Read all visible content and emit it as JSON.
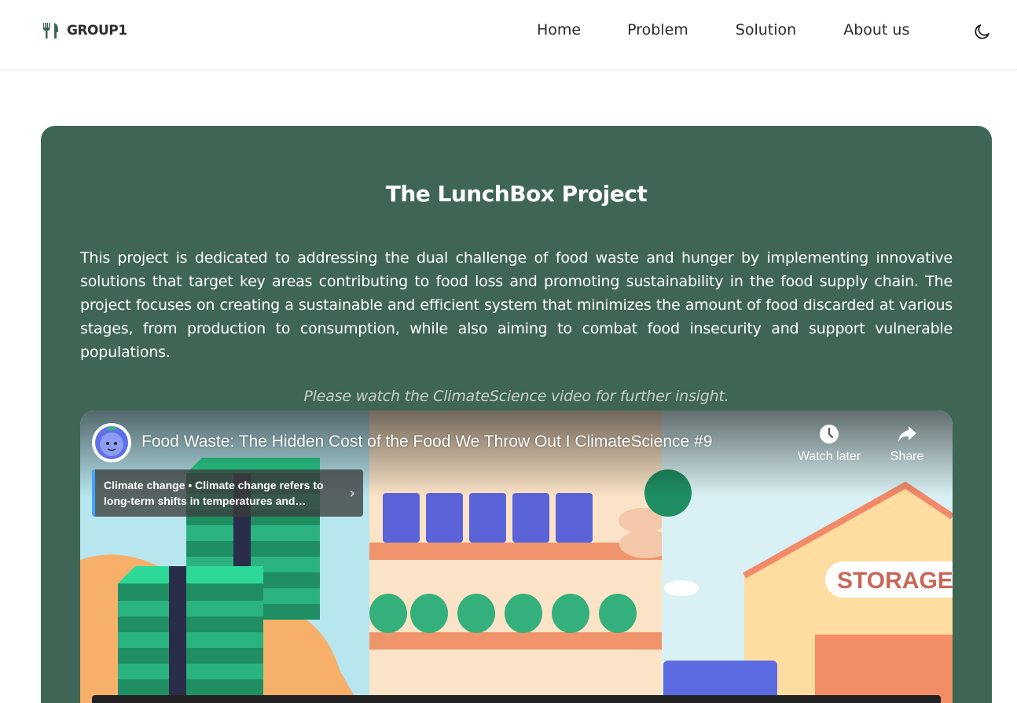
{
  "header": {
    "brand": "GROUP1",
    "brand_icon": "utensils-icon",
    "nav": [
      "Home",
      "Problem",
      "Solution",
      "About us"
    ],
    "theme_icon": "moon-icon"
  },
  "hero": {
    "title": "The LunchBox Project",
    "description": "This project is dedicated to addressing the dual challenge of food waste and hunger by implementing innovative solutions that target key areas contributing to food loss and promoting sustainability in the food supply chain. The project focuses on creating a sustainable and efficient system that minimizes the amount of food discarded at various stages, from production to consumption, while also aiming to combat food insecurity and support vulnerable populations.",
    "note": "Please watch the ClimateScience video for further insight."
  },
  "video": {
    "title": "Food Waste: The Hidden Cost of the Food We Throw Out I ClimateScience #9",
    "watch_later": "Watch later",
    "share": "Share",
    "info_card": "Climate change • Climate change refers to long-term shifts in temperatures and…",
    "scene_sign": "STORAGE"
  },
  "colors": {
    "card_bg": "#3f6654",
    "brand_icon": "#3f6654",
    "info_accent": "#3ea6ff"
  }
}
